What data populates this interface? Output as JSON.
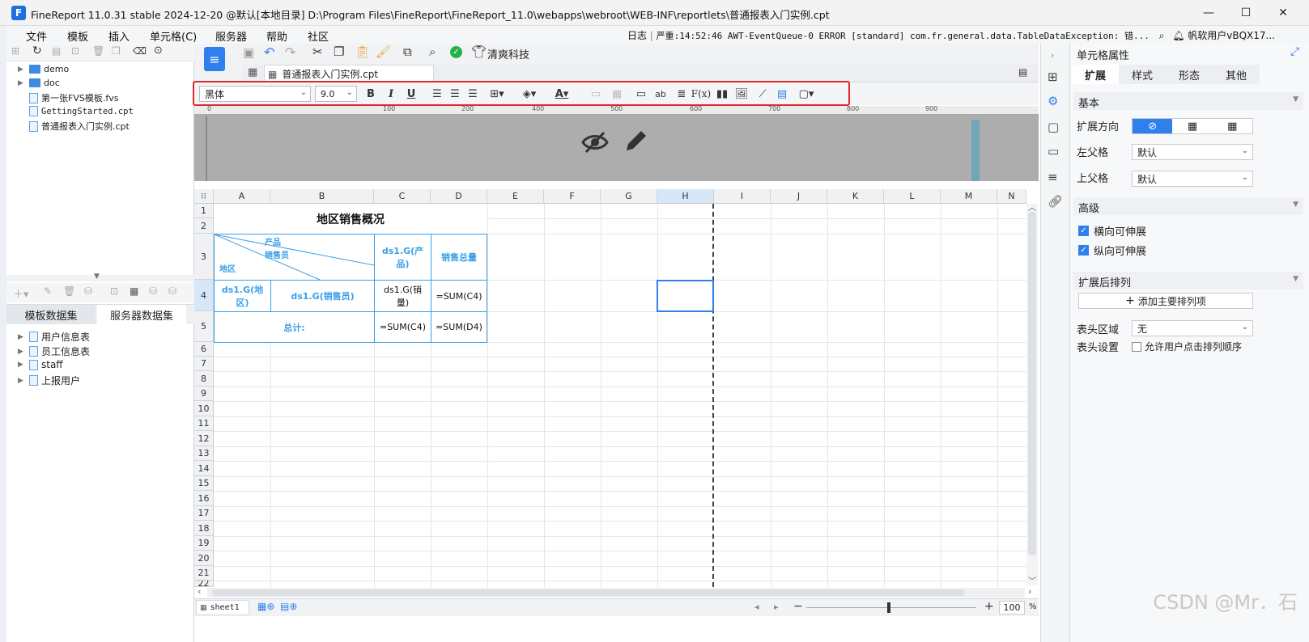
{
  "window": {
    "title": "FineReport 11.0.31 stable 2024-12-20 @默认[本地目录]    D:\\Program Files\\FineReport\\FineReport_11.0\\webapps\\webroot\\WEB-INF\\reportlets\\普通报表入门实例.cpt",
    "logo": "F"
  },
  "menubar": {
    "items": [
      "文件",
      "模板",
      "插入",
      "单元格(C)",
      "服务器",
      "帮助",
      "社区"
    ],
    "log_label": "日志",
    "log_text": "严重:14:52:46 AWT-EventQueue-0 ERROR [standard] com.fr.general.data.TableDataException: 错...",
    "user": "帆软用户vBQX17..."
  },
  "toolbar": {
    "brand_label": "清爽科技"
  },
  "tabs": [
    {
      "label": "普通报表入门实例.cpt"
    }
  ],
  "format_bar": {
    "font": "黑体",
    "size": "9.0"
  },
  "ruler": {
    "ticks": [
      "0",
      "100",
      "200",
      "300",
      "400",
      "500",
      "600",
      "700",
      "800",
      "900"
    ]
  },
  "file_tree": [
    {
      "label": "demo",
      "type": "folder"
    },
    {
      "label": "doc",
      "type": "folder"
    },
    {
      "label": "第一张FVS模板.fvs",
      "type": "file"
    },
    {
      "label": "GettingStarted.cpt",
      "type": "file"
    },
    {
      "label": "普通报表入门实例.cpt",
      "type": "file"
    }
  ],
  "dataset_tabs": [
    "模板数据集",
    "服务器数据集"
  ],
  "datasets": [
    "用户信息表",
    "员工信息表",
    "staff",
    "上报用户"
  ],
  "sheet": {
    "columns": [
      "A",
      "B",
      "C",
      "D",
      "E",
      "F",
      "G",
      "H",
      "I",
      "J",
      "K",
      "L",
      "M",
      "N"
    ],
    "rows": [
      "1",
      "2",
      "3",
      "4",
      "5",
      "6",
      "7",
      "8",
      "9",
      "10",
      "11",
      "12",
      "13",
      "14",
      "15",
      "16",
      "17",
      "18",
      "19",
      "20",
      "21",
      "22"
    ],
    "title_cell": "地区销售概况",
    "diag_product": "产品",
    "diag_seller": "销售员",
    "diag_region": "地区",
    "c3": "ds1.G(产品)",
    "d3": "销售总量",
    "a4": "ds1.G(地区)",
    "b4": "ds1.G(销售员)",
    "c4": "ds1.G(销量)",
    "d4": "=SUM(C4)",
    "a5": "总计:",
    "c5": "=SUM(C4)",
    "d5": "=SUM(D4)"
  },
  "bottom": {
    "sheet_tab": "sheet1",
    "zoom": "100",
    "zoom_unit": "%"
  },
  "right_panel": {
    "header": "单元格属性",
    "tabs": [
      "扩展",
      "样式",
      "形态",
      "其他"
    ],
    "basic": "基本",
    "expand_dir": "扩展方向",
    "left_parent": "左父格",
    "left_parent_val": "默认",
    "up_parent": "上父格",
    "up_parent_val": "默认",
    "advanced": "高级",
    "h_expand": "横向可伸展",
    "v_expand": "纵向可伸展",
    "sort_after": "扩展后排列",
    "add_sort": "添加主要排列项",
    "header_area": "表头区域",
    "header_area_val": "无",
    "header_setting": "表头设置",
    "allow_sort": "允许用户点击排列顺序"
  },
  "watermark": "CSDN @Mr．石",
  "colors": {
    "accent": "#2f80ed",
    "cell_border": "#3aa0e8",
    "highlight_box": "#e0282a"
  }
}
